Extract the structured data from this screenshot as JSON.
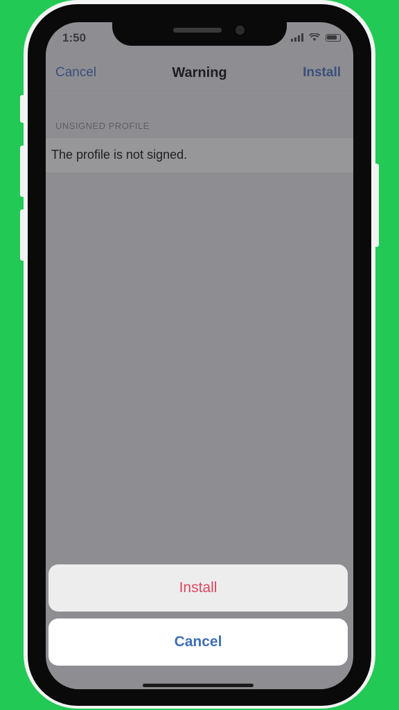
{
  "status_bar": {
    "time": "1:50"
  },
  "navbar": {
    "cancel_label": "Cancel",
    "title": "Warning",
    "install_label": "Install"
  },
  "section": {
    "header": "UNSIGNED PROFILE",
    "row_text": "The profile is not signed."
  },
  "action_sheet": {
    "install_label": "Install",
    "cancel_label": "Cancel"
  },
  "colors": {
    "background": "#22c955",
    "overlay": "#8e8e92",
    "destructive": "#d9475e",
    "accent": "#3f6eb5"
  }
}
